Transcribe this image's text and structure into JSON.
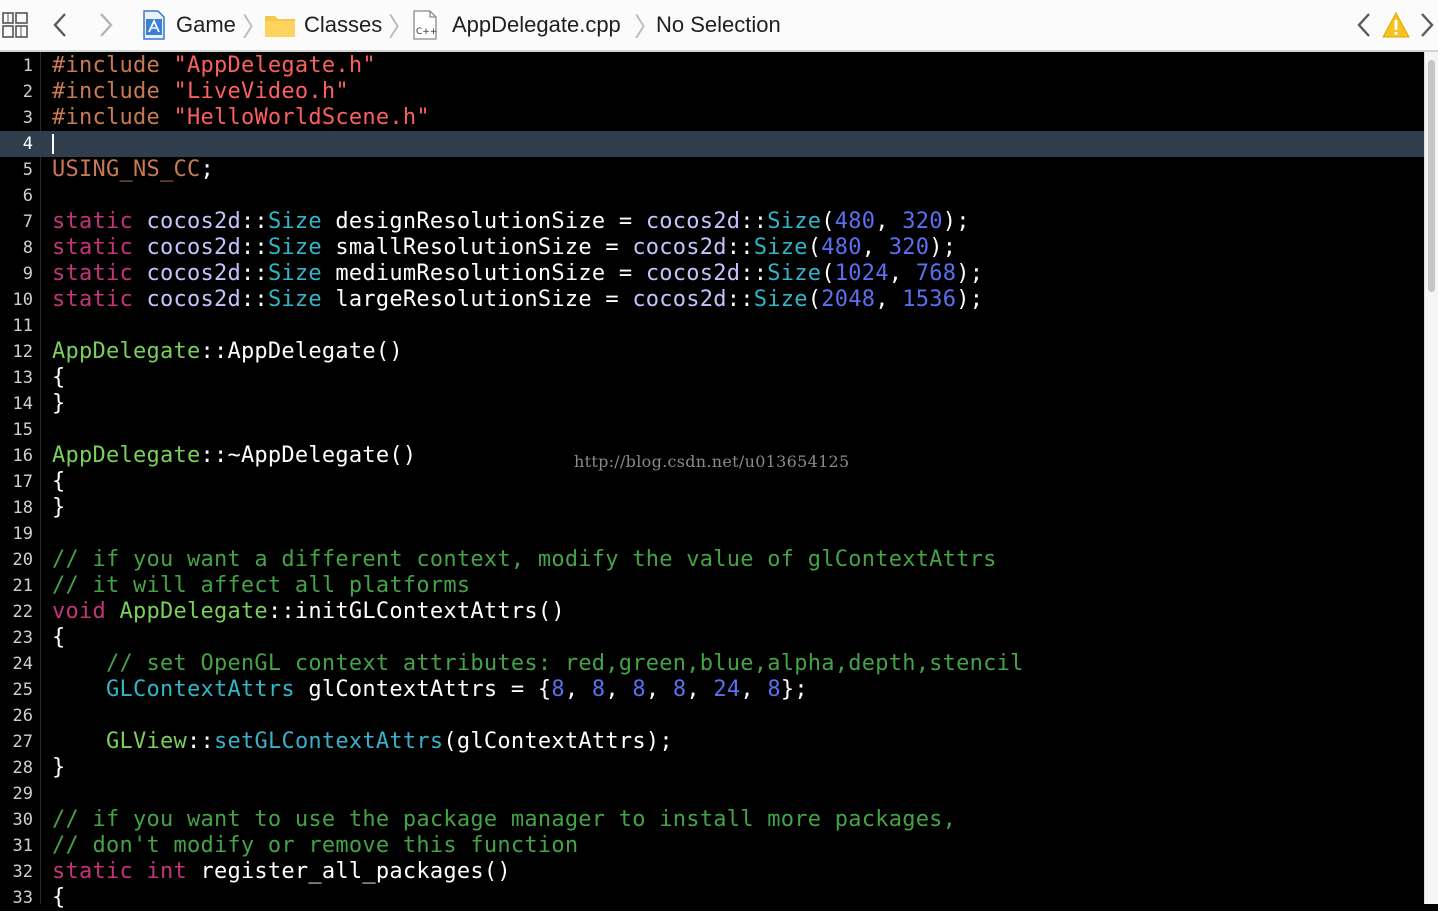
{
  "jumpbar": {
    "related_icon": "related-items-grid-icon",
    "back_icon": "chevron-left-icon",
    "forward_icon": "chevron-right-icon",
    "crumbs": [
      {
        "label": "Game",
        "icon": "xcode-project-icon"
      },
      {
        "label": "Classes",
        "icon": "folder-icon"
      },
      {
        "label": "AppDelegate.cpp",
        "icon": "cpp-file-icon"
      },
      {
        "label": "No Selection",
        "icon": ""
      }
    ],
    "warning_icon": "warning-triangle-icon"
  },
  "editor": {
    "current_line": 4,
    "lines": [
      {
        "n": "1",
        "tokens": [
          [
            "pre",
            "#include "
          ],
          [
            "str",
            "\"AppDelegate.h\""
          ]
        ]
      },
      {
        "n": "2",
        "tokens": [
          [
            "pre",
            "#include "
          ],
          [
            "str",
            "\"LiveVideo.h\""
          ]
        ]
      },
      {
        "n": "3",
        "tokens": [
          [
            "pre",
            "#include "
          ],
          [
            "str",
            "\"HelloWorldScene.h\""
          ]
        ]
      },
      {
        "n": "4",
        "tokens": []
      },
      {
        "n": "5",
        "tokens": [
          [
            "pre",
            "USING_NS_CC"
          ],
          [
            "def",
            ";"
          ]
        ]
      },
      {
        "n": "6",
        "tokens": []
      },
      {
        "n": "7",
        "tokens": [
          [
            "kw",
            "static "
          ],
          [
            "ns",
            "cocos2d"
          ],
          [
            "def",
            "::"
          ],
          [
            "ty2",
            "Size"
          ],
          [
            "def",
            " designResolutionSize = "
          ],
          [
            "ns",
            "cocos2d"
          ],
          [
            "def",
            "::"
          ],
          [
            "ty2",
            "Size"
          ],
          [
            "def",
            "("
          ],
          [
            "num",
            "480"
          ],
          [
            "def",
            ", "
          ],
          [
            "num",
            "320"
          ],
          [
            "def",
            ");"
          ]
        ]
      },
      {
        "n": "8",
        "tokens": [
          [
            "kw",
            "static "
          ],
          [
            "ns",
            "cocos2d"
          ],
          [
            "def",
            "::"
          ],
          [
            "ty2",
            "Size"
          ],
          [
            "def",
            " smallResolutionSize = "
          ],
          [
            "ns",
            "cocos2d"
          ],
          [
            "def",
            "::"
          ],
          [
            "ty2",
            "Size"
          ],
          [
            "def",
            "("
          ],
          [
            "num",
            "480"
          ],
          [
            "def",
            ", "
          ],
          [
            "num",
            "320"
          ],
          [
            "def",
            ");"
          ]
        ]
      },
      {
        "n": "9",
        "tokens": [
          [
            "kw",
            "static "
          ],
          [
            "ns",
            "cocos2d"
          ],
          [
            "def",
            "::"
          ],
          [
            "ty2",
            "Size"
          ],
          [
            "def",
            " mediumResolutionSize = "
          ],
          [
            "ns",
            "cocos2d"
          ],
          [
            "def",
            "::"
          ],
          [
            "ty2",
            "Size"
          ],
          [
            "def",
            "("
          ],
          [
            "num",
            "1024"
          ],
          [
            "def",
            ", "
          ],
          [
            "num",
            "768"
          ],
          [
            "def",
            ");"
          ]
        ]
      },
      {
        "n": "10",
        "tokens": [
          [
            "kw",
            "static "
          ],
          [
            "ns",
            "cocos2d"
          ],
          [
            "def",
            "::"
          ],
          [
            "ty2",
            "Size"
          ],
          [
            "def",
            " largeResolutionSize = "
          ],
          [
            "ns",
            "cocos2d"
          ],
          [
            "def",
            "::"
          ],
          [
            "ty2",
            "Size"
          ],
          [
            "def",
            "("
          ],
          [
            "num",
            "2048"
          ],
          [
            "def",
            ", "
          ],
          [
            "num",
            "1536"
          ],
          [
            "def",
            ");"
          ]
        ]
      },
      {
        "n": "11",
        "tokens": []
      },
      {
        "n": "12",
        "tokens": [
          [
            "ty",
            "AppDelegate"
          ],
          [
            "def",
            "::AppDelegate()"
          ]
        ]
      },
      {
        "n": "13",
        "tokens": [
          [
            "def",
            "{"
          ]
        ]
      },
      {
        "n": "14",
        "tokens": [
          [
            "def",
            "}"
          ]
        ]
      },
      {
        "n": "15",
        "tokens": []
      },
      {
        "n": "16",
        "tokens": [
          [
            "ty",
            "AppDelegate"
          ],
          [
            "def",
            "::~AppDelegate()"
          ]
        ]
      },
      {
        "n": "17",
        "tokens": [
          [
            "def",
            "{"
          ]
        ]
      },
      {
        "n": "18",
        "tokens": [
          [
            "def",
            "}"
          ]
        ]
      },
      {
        "n": "19",
        "tokens": []
      },
      {
        "n": "20",
        "tokens": [
          [
            "com",
            "// if you want a different context, modify the value of glContextAttrs"
          ]
        ]
      },
      {
        "n": "21",
        "tokens": [
          [
            "com",
            "// it will affect all platforms"
          ]
        ]
      },
      {
        "n": "22",
        "tokens": [
          [
            "kw",
            "void "
          ],
          [
            "ty",
            "AppDelegate"
          ],
          [
            "def",
            "::initGLContextAttrs()"
          ]
        ]
      },
      {
        "n": "23",
        "tokens": [
          [
            "def",
            "{"
          ]
        ]
      },
      {
        "n": "24",
        "tokens": [
          [
            "def",
            "    "
          ],
          [
            "com",
            "// set OpenGL context attributes: red,green,blue,alpha,depth,stencil"
          ]
        ]
      },
      {
        "n": "25",
        "tokens": [
          [
            "def",
            "    "
          ],
          [
            "ty2",
            "GLContextAttrs"
          ],
          [
            "def",
            " glContextAttrs = {"
          ],
          [
            "num",
            "8"
          ],
          [
            "def",
            ", "
          ],
          [
            "num",
            "8"
          ],
          [
            "def",
            ", "
          ],
          [
            "num",
            "8"
          ],
          [
            "def",
            ", "
          ],
          [
            "num",
            "8"
          ],
          [
            "def",
            ", "
          ],
          [
            "num",
            "24"
          ],
          [
            "def",
            ", "
          ],
          [
            "num",
            "8"
          ],
          [
            "def",
            "};"
          ]
        ]
      },
      {
        "n": "26",
        "tokens": []
      },
      {
        "n": "27",
        "tokens": [
          [
            "def",
            "    "
          ],
          [
            "ty",
            "GLView"
          ],
          [
            "def",
            "::"
          ],
          [
            "fn",
            "setGLContextAttrs"
          ],
          [
            "def",
            "(glContextAttrs);"
          ]
        ]
      },
      {
        "n": "28",
        "tokens": [
          [
            "def",
            "}"
          ]
        ]
      },
      {
        "n": "29",
        "tokens": []
      },
      {
        "n": "30",
        "tokens": [
          [
            "com",
            "// if you want to use the package manager to install more packages,"
          ]
        ]
      },
      {
        "n": "31",
        "tokens": [
          [
            "com",
            "// don't modify or remove this function"
          ]
        ]
      },
      {
        "n": "32",
        "tokens": [
          [
            "kw",
            "static int "
          ],
          [
            "def",
            "register_all_packages()"
          ]
        ]
      },
      {
        "n": "33",
        "tokens": [
          [
            "def",
            "{"
          ]
        ]
      }
    ]
  },
  "watermark": "http://blog.csdn.net/u013654125"
}
